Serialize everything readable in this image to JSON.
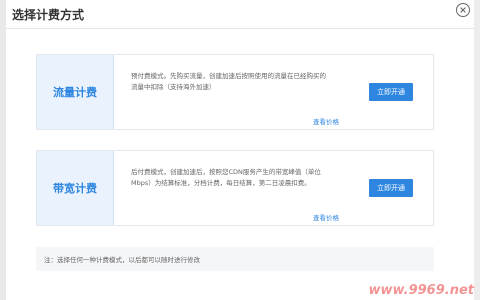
{
  "dialog": {
    "title": "选择计费方式"
  },
  "plans": [
    {
      "name": "流量计费",
      "description": "预付费模式。先购买流量，创建加速后按照使用的流量在已经购买的流量中扣除（支持海外加速）",
      "price_link": "查看价格",
      "button": "立即开通"
    },
    {
      "name": "带宽计费",
      "description": "后付费模式，创建加速后，按照您CDN服务产生的带宽峰值（单位Mbps）为结算标准，分档计费，每日结算，第二日凌晨扣费。",
      "price_link": "查看价格",
      "button": "立即开通"
    }
  ],
  "note": "注：选择任何一种计费模式，以后都可以随时进行修改",
  "watermark": "www.9969.net",
  "icons": {
    "close": "close-icon"
  },
  "colors": {
    "accent": "#2e86e0",
    "plan_bg": "#eaf3fd"
  }
}
